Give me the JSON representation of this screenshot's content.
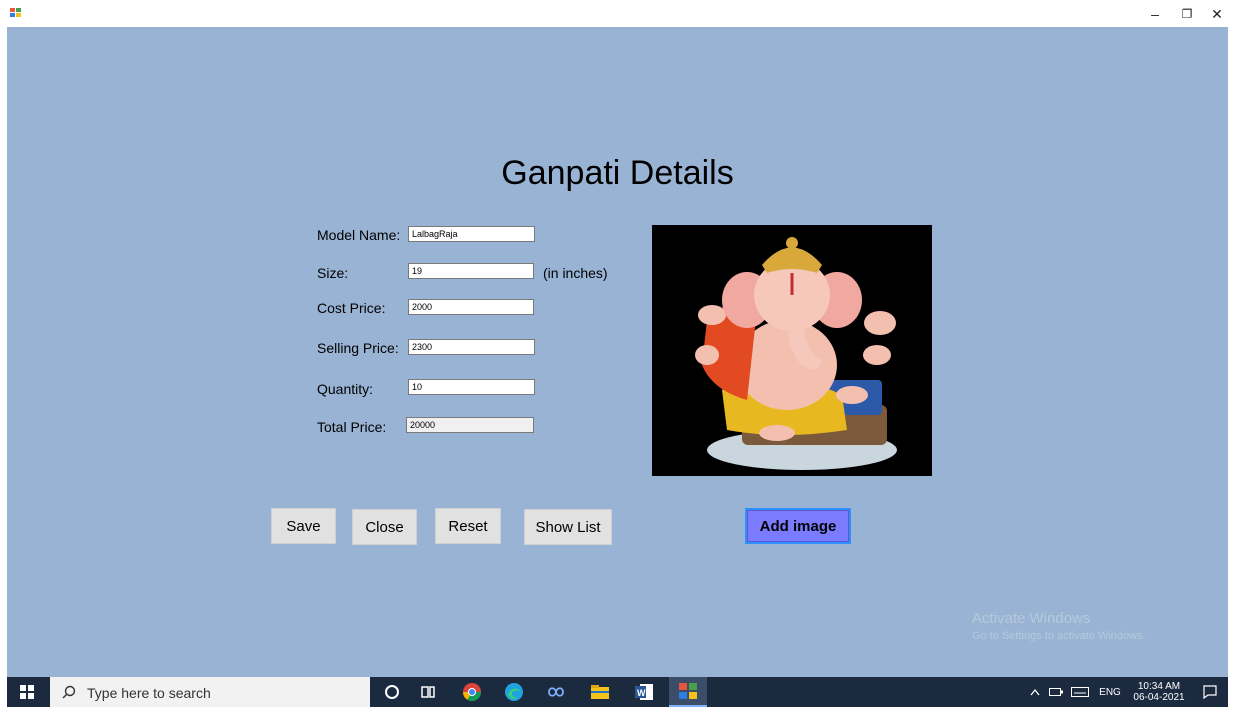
{
  "window": {
    "minimize_glyph": "–",
    "restore_glyph": "❐",
    "close_glyph": "✕"
  },
  "form": {
    "title": "Ganpati Details",
    "fields": {
      "model_name": {
        "label": "Model Name:",
        "value": "LalbagRaja"
      },
      "size": {
        "label": "Size:",
        "value": "19",
        "unit": "(in inches)"
      },
      "cost_price": {
        "label": "Cost Price:",
        "value": "2000"
      },
      "selling_price": {
        "label": "Selling Price:",
        "value": "2300"
      },
      "quantity": {
        "label": "Quantity:",
        "value": "10"
      },
      "total_price": {
        "label": "Total Price:",
        "value": "20000"
      }
    },
    "buttons": {
      "save": "Save",
      "close": "Close",
      "reset": "Reset",
      "show_list": "Show List",
      "add_image": "Add image"
    },
    "image": {
      "subject": "Ganpati idol"
    }
  },
  "watermark": {
    "line1": "Activate Windows",
    "line2": "Go to Settings to activate Windows."
  },
  "taskbar": {
    "search_placeholder": "Type here to search",
    "language": "ENG",
    "time": "10:34 AM",
    "date": "06-04-2021",
    "colors": {
      "background": "#1c2a3f",
      "accent": "#7b7bff"
    }
  }
}
